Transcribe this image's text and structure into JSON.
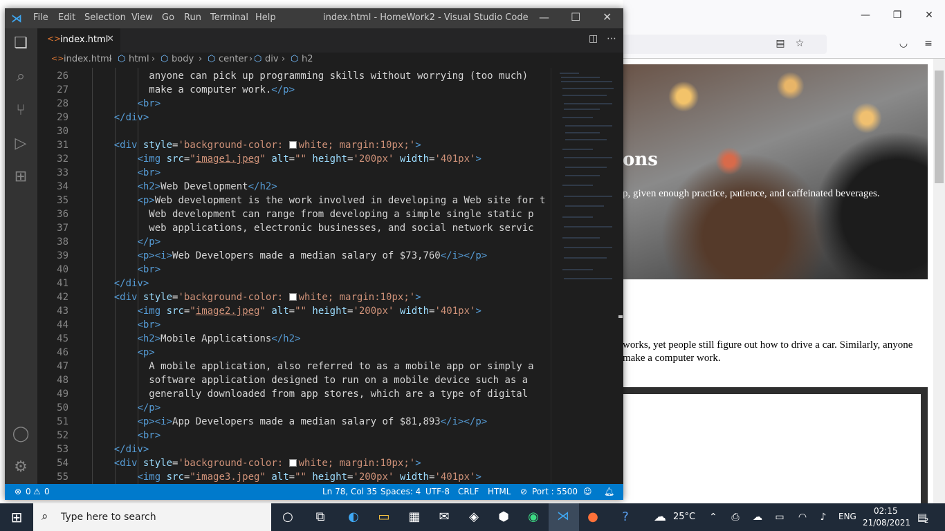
{
  "vscode": {
    "menu": [
      "File",
      "Edit",
      "Selection",
      "View",
      "Go",
      "Run",
      "Terminal",
      "Help"
    ],
    "window_title": "index.html - HomeWork2 - Visual Studio Code",
    "tab_label": "index.html",
    "breadcrumb": [
      "index.html",
      "html",
      "body",
      "center",
      "div",
      "h2"
    ],
    "lines": [
      {
        "n": "26",
        "html": "          anyone can pick up programming skills without worrying (too much)"
      },
      {
        "n": "27",
        "html": "          make a computer work.<span class=\"t\">&lt;/p&gt;</span>"
      },
      {
        "n": "28",
        "html": "        <span class=\"t\">&lt;br&gt;</span>"
      },
      {
        "n": "29",
        "html": "    <span class=\"t\">&lt;/div&gt;</span>"
      },
      {
        "n": "30",
        "html": ""
      },
      {
        "n": "31",
        "html": "    <span class=\"t\">&lt;div</span> <span class=\"a\">style</span>=<span class=\"s\">'background-color: <span class=\"sw\"></span>white; margin:10px;'</span><span class=\"t\">&gt;</span>"
      },
      {
        "n": "32",
        "html": "        <span class=\"t\">&lt;img</span> <span class=\"a\">src</span>=<span class=\"s\">\"<span class=\"u\">image1.jpeg</span>\"</span> <span class=\"a\">alt</span>=<span class=\"s\">\"\"</span> <span class=\"a\">height</span>=<span class=\"s\">'200px'</span> <span class=\"a\">width</span>=<span class=\"s\">'401px'</span><span class=\"t\">&gt;</span>"
      },
      {
        "n": "33",
        "html": "        <span class=\"t\">&lt;br&gt;</span>"
      },
      {
        "n": "34",
        "html": "        <span class=\"t\">&lt;h2&gt;</span>Web Development<span class=\"t\">&lt;/h2&gt;</span>"
      },
      {
        "n": "35",
        "html": "        <span class=\"t\">&lt;p&gt;</span>Web development is the work involved in developing a Web site for t"
      },
      {
        "n": "36",
        "html": "          Web development can range from developing a simple single static p"
      },
      {
        "n": "37",
        "html": "          web applications, electronic businesses, and social network servic"
      },
      {
        "n": "38",
        "html": "        <span class=\"t\">&lt;/p&gt;</span>"
      },
      {
        "n": "39",
        "html": "        <span class=\"t\">&lt;p&gt;&lt;i&gt;</span>Web Developers made a median salary of $73,760<span class=\"t\">&lt;/i&gt;&lt;/p&gt;</span>"
      },
      {
        "n": "40",
        "html": "        <span class=\"t\">&lt;br&gt;</span>"
      },
      {
        "n": "41",
        "html": "    <span class=\"t\">&lt;/div&gt;</span>"
      },
      {
        "n": "42",
        "html": "    <span class=\"t\">&lt;div</span> <span class=\"a\">style</span>=<span class=\"s\">'background-color: <span class=\"sw\"></span>white; margin:10px;'</span><span class=\"t\">&gt;</span>"
      },
      {
        "n": "43",
        "html": "        <span class=\"t\">&lt;img</span> <span class=\"a\">src</span>=<span class=\"s\">\"<span class=\"u\">image2.jpeg</span>\"</span> <span class=\"a\">alt</span>=<span class=\"s\">\"\"</span> <span class=\"a\">height</span>=<span class=\"s\">'200px'</span> <span class=\"a\">width</span>=<span class=\"s\">'401px'</span><span class=\"t\">&gt;</span>"
      },
      {
        "n": "44",
        "html": "        <span class=\"t\">&lt;br&gt;</span>"
      },
      {
        "n": "45",
        "html": "        <span class=\"t\">&lt;h2&gt;</span>Mobile Applications<span class=\"t\">&lt;/h2&gt;</span>"
      },
      {
        "n": "46",
        "html": "        <span class=\"t\">&lt;p&gt;</span>"
      },
      {
        "n": "47",
        "html": "          A mobile application, also referred to as a mobile app or simply a"
      },
      {
        "n": "48",
        "html": "          software application designed to run on a mobile device such as a"
      },
      {
        "n": "49",
        "html": "          generally downloaded from app stores, which are a type of digital"
      },
      {
        "n": "50",
        "html": "        <span class=\"t\">&lt;/p&gt;</span>"
      },
      {
        "n": "51",
        "html": "        <span class=\"t\">&lt;p&gt;&lt;i&gt;</span>App Developers made a median salary of $81,893<span class=\"t\">&lt;/i&gt;&lt;/p&gt;</span>"
      },
      {
        "n": "52",
        "html": "        <span class=\"t\">&lt;br&gt;</span>"
      },
      {
        "n": "53",
        "html": "    <span class=\"t\">&lt;/div&gt;</span>"
      },
      {
        "n": "54",
        "html": "    <span class=\"t\">&lt;div</span> <span class=\"a\">style</span>=<span class=\"s\">'background-color: <span class=\"sw\"></span>white; margin:10px;'</span><span class=\"t\">&gt;</span>"
      },
      {
        "n": "55",
        "html": "        <span class=\"t\">&lt;img</span> <span class=\"a\">src</span>=<span class=\"s\">\"image3.jpeg\"</span> <span class=\"a\">alt</span>=<span class=\"s\">\"\"</span> <span class=\"a\">height</span>=<span class=\"s\">'200px'</span> <span class=\"a\">width</span>=<span class=\"s\">'401px'</span><span class=\"t\">&gt;</span>"
      }
    ],
    "status": {
      "errors": "0",
      "warnings": "0",
      "position": "Ln 78, Col 35",
      "spaces": "Spaces: 4",
      "encoding": "UTF-8",
      "eol": "CRLF",
      "language": "HTML",
      "port": "Port : 5500"
    }
  },
  "browser": {
    "hero_title": "ons",
    "hero_text": "p, given enough practice, patience, and caffeinated beverages.",
    "para": "works, yet people still figure out how to drive a car. Similarly, anyone make a computer work."
  },
  "taskbar": {
    "search_placeholder": "Type here to search",
    "temperature": "25°C",
    "language": "ENG",
    "time": "02:15",
    "date": "21/08/2021",
    "notifications": "2"
  },
  "colors": {
    "statusbar": "#007acc",
    "titlebar": "#3c3c3c",
    "editor": "#1e1e1e"
  }
}
